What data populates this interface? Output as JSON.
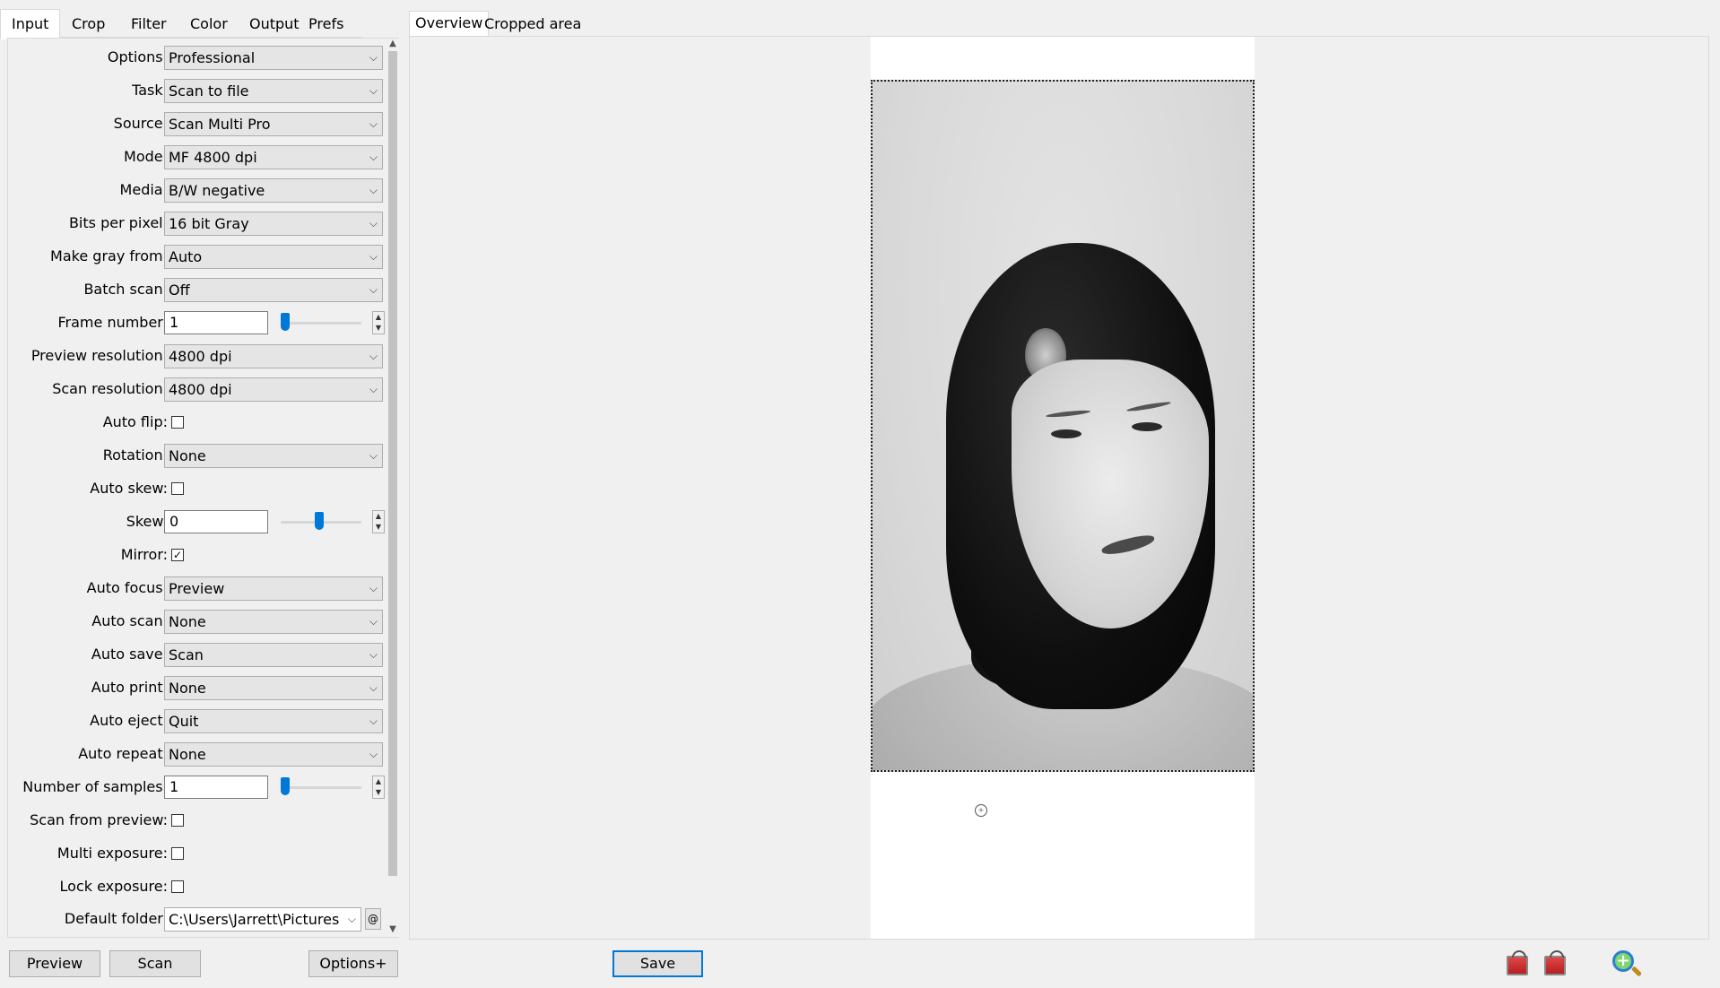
{
  "left_tabs": [
    "Input",
    "Crop",
    "Filter",
    "Color",
    "Output",
    "Prefs"
  ],
  "right_tabs": [
    "Overview",
    "Cropped area"
  ],
  "settings": {
    "options": {
      "label": "Options:",
      "value": "Professional"
    },
    "task": {
      "label": "Task:",
      "value": "Scan to file"
    },
    "source": {
      "label": "Source:",
      "value": "Scan Multi Pro"
    },
    "mode": {
      "label": "Mode:",
      "value": "MF 4800 dpi"
    },
    "media": {
      "label": "Media:",
      "value": "B/W negative"
    },
    "bits": {
      "label": "Bits per pixel:",
      "value": "16 bit Gray"
    },
    "makegray": {
      "label": "Make gray from:",
      "value": "Auto"
    },
    "batch": {
      "label": "Batch scan:",
      "value": "Off"
    },
    "frame": {
      "label": "Frame number:",
      "value": "1"
    },
    "previewres": {
      "label": "Preview resolution:",
      "value": "4800 dpi"
    },
    "scanres": {
      "label": "Scan resolution:",
      "value": "4800 dpi"
    },
    "autoflip": {
      "label": "Auto flip:",
      "checked": false
    },
    "rotation": {
      "label": "Rotation:",
      "value": "None"
    },
    "autoskew": {
      "label": "Auto skew:",
      "checked": false
    },
    "skew": {
      "label": "Skew:",
      "value": "0"
    },
    "mirror": {
      "label": "Mirror:",
      "checked": true
    },
    "autofocus": {
      "label": "Auto focus:",
      "value": "Preview"
    },
    "autoscan": {
      "label": "Auto scan:",
      "value": "None"
    },
    "autosave": {
      "label": "Auto save:",
      "value": "Scan"
    },
    "autoprint": {
      "label": "Auto print:",
      "value": "None"
    },
    "autoeject": {
      "label": "Auto eject:",
      "value": "Quit"
    },
    "autorepeat": {
      "label": "Auto repeat:",
      "value": "None"
    },
    "samples": {
      "label": "Number of samples:",
      "value": "1"
    },
    "scanfrompreview": {
      "label": "Scan from preview:",
      "checked": false
    },
    "multiexposure": {
      "label": "Multi exposure:",
      "checked": false
    },
    "lockexposure": {
      "label": "Lock exposure:",
      "checked": false
    },
    "defaultfolder": {
      "label": "Default folder:",
      "value": "C:\\Users\\Jarrett\\Pictures"
    }
  },
  "buttons": {
    "preview": "Preview",
    "scan": "Scan",
    "options_plus": "Options+",
    "save": "Save"
  },
  "icons": {
    "checkmark": "✓",
    "chevron": "⌵",
    "spin_up": "▲",
    "spin_down": "▼",
    "at": "@",
    "plus": "+"
  },
  "colors": {
    "accent": "#0078d7"
  }
}
